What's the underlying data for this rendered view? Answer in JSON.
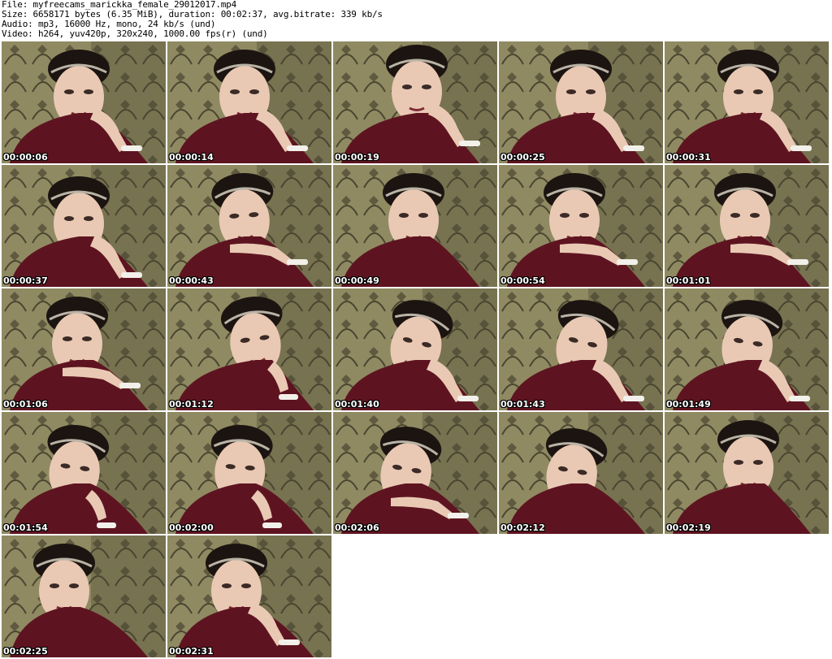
{
  "header": {
    "file_line": "File: myfreecams_marickka_female_29012017.mp4",
    "size_line": "Size: 6658171 bytes (6.35 MiB), duration: 00:02:37, avg.bitrate: 339 kb/s",
    "audio_line": "Audio: mp3, 16000 Hz, mono, 24 kb/s (und)",
    "video_line": "Video: h264, yuv420p, 320x240, 1000.00 fps(r) (und)"
  },
  "thumbnails": [
    {
      "timestamp": "00:00:06"
    },
    {
      "timestamp": "00:00:14"
    },
    {
      "timestamp": "00:00:19"
    },
    {
      "timestamp": "00:00:25"
    },
    {
      "timestamp": "00:00:31"
    },
    {
      "timestamp": "00:00:37"
    },
    {
      "timestamp": "00:00:43"
    },
    {
      "timestamp": "00:00:49"
    },
    {
      "timestamp": "00:00:54"
    },
    {
      "timestamp": "00:01:01"
    },
    {
      "timestamp": "00:01:06"
    },
    {
      "timestamp": "00:01:12"
    },
    {
      "timestamp": "00:01:40"
    },
    {
      "timestamp": "00:01:43"
    },
    {
      "timestamp": "00:01:49"
    },
    {
      "timestamp": "00:01:54"
    },
    {
      "timestamp": "00:02:00"
    },
    {
      "timestamp": "00:02:06"
    },
    {
      "timestamp": "00:02:12"
    },
    {
      "timestamp": "00:02:19"
    },
    {
      "timestamp": "00:02:25"
    },
    {
      "timestamp": "00:02:31"
    }
  ],
  "colors": {
    "wall": "#8f8a62",
    "wall_dark": "#4a4530",
    "hair": "#1c1410",
    "skin": "#e9c9b4",
    "shirt": "#5e1420",
    "bracelet": "#f2f0ea"
  }
}
